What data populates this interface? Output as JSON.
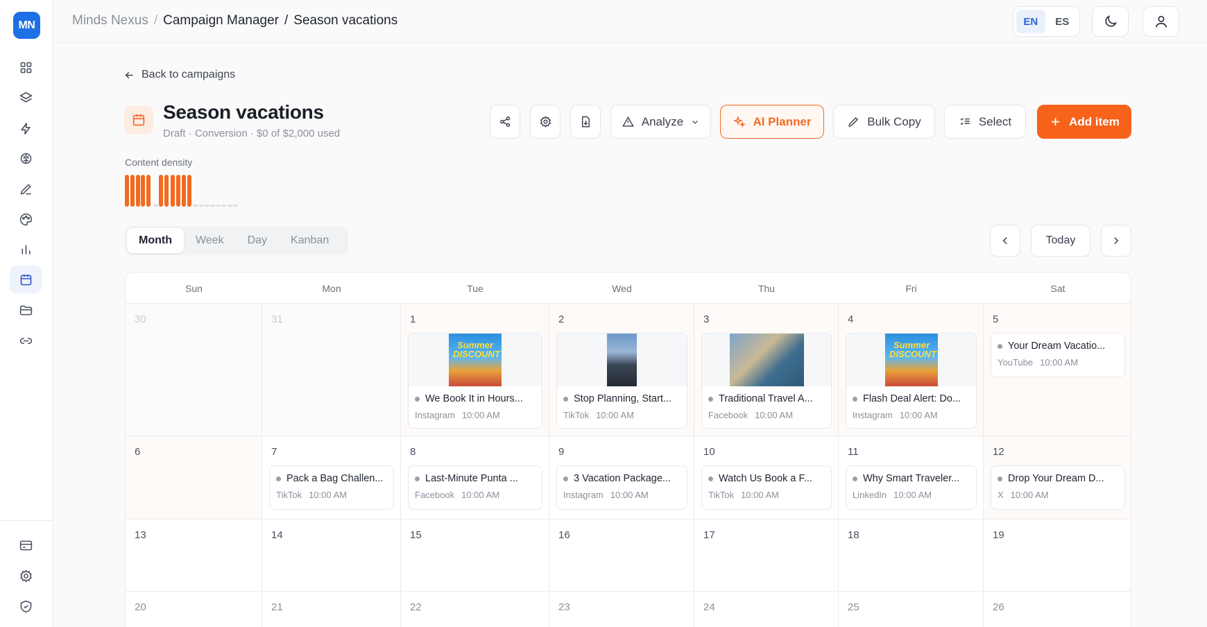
{
  "brand": {
    "logo_text": "MN",
    "accent": "#f7631b",
    "primary": "#1f6fe5"
  },
  "sidebar": {
    "items": [
      {
        "icon": "grid-icon"
      },
      {
        "icon": "layers-icon"
      },
      {
        "icon": "bolt-icon"
      },
      {
        "icon": "brain-icon"
      },
      {
        "icon": "pen-icon"
      },
      {
        "icon": "palette-icon"
      },
      {
        "icon": "bar-chart-icon"
      },
      {
        "icon": "calendar-icon",
        "active": true
      },
      {
        "icon": "folder-icon"
      },
      {
        "icon": "link-icon"
      }
    ],
    "bottom": [
      {
        "icon": "card-icon"
      },
      {
        "icon": "gear-icon"
      },
      {
        "icon": "shield-icon"
      }
    ]
  },
  "breadcrumb": {
    "root": "Minds Nexus",
    "section": "Campaign Manager",
    "page": "Season vacations",
    "sep": "/"
  },
  "lang": {
    "en": "EN",
    "es": "ES",
    "active": "EN"
  },
  "header": {
    "back_label": "Back to campaigns",
    "title": "Season vacations",
    "subtitle": "Draft · Conversion · $0 of $2,000 used"
  },
  "toolbar": {
    "analyze": "Analyze",
    "ai_planner": "AI Planner",
    "bulk_copy": "Bulk Copy",
    "select": "Select",
    "add_item": "Add item"
  },
  "density": {
    "label": "Content density",
    "values": [
      1,
      1,
      1,
      1,
      1,
      0,
      1,
      1,
      1,
      1,
      1,
      1,
      0,
      0,
      0,
      0,
      0,
      0,
      0,
      0
    ]
  },
  "views": {
    "tabs": [
      "Month",
      "Week",
      "Day",
      "Kanban"
    ],
    "active": "Month"
  },
  "nav": {
    "today": "Today"
  },
  "calendar": {
    "weekdays": [
      "Sun",
      "Mon",
      "Tue",
      "Wed",
      "Thu",
      "Fri",
      "Sat"
    ],
    "weeks": [
      [
        "30",
        "31",
        "1",
        "2",
        "3",
        "4",
        "5"
      ],
      [
        "6",
        "7",
        "8",
        "9",
        "10",
        "11",
        "12"
      ],
      [
        "13",
        "14",
        "15",
        "16",
        "17",
        "18",
        "19"
      ],
      [
        "20",
        "21",
        "22",
        "23",
        "24",
        "25",
        "26"
      ]
    ],
    "posts": [
      {
        "title": "We Book It in Hours...",
        "platform": "Instagram",
        "time": "10:00 AM",
        "thumb": "summer-discount"
      },
      {
        "title": "Stop Planning, Start...",
        "platform": "TikTok",
        "time": "10:00 AM",
        "thumb": "road"
      },
      {
        "title": "Traditional Travel A...",
        "platform": "Facebook",
        "time": "10:00 AM",
        "thumb": "beach"
      },
      {
        "title": "Flash Deal Alert: Do...",
        "platform": "Instagram",
        "time": "10:00 AM",
        "thumb": "summer-discount"
      },
      {
        "title": "Your Dream Vacatio...",
        "platform": "YouTube",
        "time": "10:00 AM"
      },
      {
        "title": "Pack a Bag Challen...",
        "platform": "TikTok",
        "time": "10:00 AM"
      },
      {
        "title": "Last-Minute Punta ...",
        "platform": "Facebook",
        "time": "10:00 AM"
      },
      {
        "title": "3 Vacation Package...",
        "platform": "Instagram",
        "time": "10:00 AM"
      },
      {
        "title": "Watch Us Book a F...",
        "platform": "TikTok",
        "time": "10:00 AM"
      },
      {
        "title": "Why Smart Traveler...",
        "platform": "LinkedIn",
        "time": "10:00 AM"
      },
      {
        "title": "Drop Your Dream D...",
        "platform": "X",
        "time": "10:00 AM"
      }
    ],
    "thumb_text": "Summer DISCOUNT"
  }
}
